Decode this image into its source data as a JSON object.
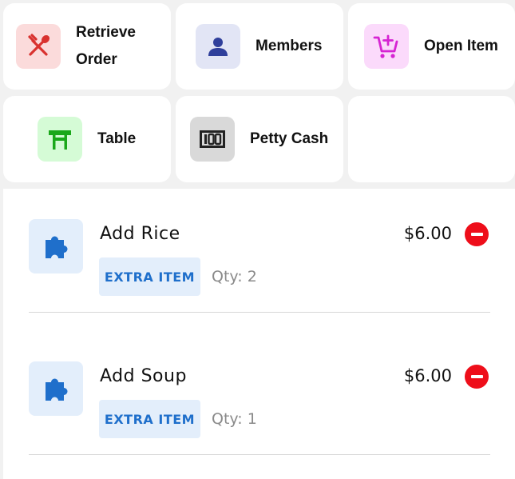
{
  "actions": {
    "retrieve_order": {
      "label": "Retrieve\nOrder",
      "icon": "utensils-icon",
      "color": "#d9322f",
      "bg": "#fbdbdb"
    },
    "members": {
      "label": "Members",
      "icon": "person-icon",
      "color": "#2f3f9b",
      "bg": "#e2e5f5"
    },
    "open_item": {
      "label": "Open Item",
      "icon": "cart-plus-icon",
      "color": "#d624d3",
      "bg": "#fbdafb"
    },
    "table": {
      "label": "Table",
      "icon": "table-icon",
      "color": "#1aa81a",
      "bg": "#d5fbd6"
    },
    "petty_cash": {
      "label": "Petty Cash",
      "icon": "cash-icon",
      "color": "#222222",
      "bg": "#d9d9d9"
    }
  },
  "order_items": [
    {
      "name": "Add Rice",
      "price": "$6.00",
      "badge": "EXTRA ITEM",
      "qty": "Qty: 2",
      "icon": "puzzle-icon"
    },
    {
      "name": "Add Soup",
      "price": "$6.00",
      "badge": "EXTRA ITEM",
      "qty": "Qty: 1",
      "icon": "puzzle-icon"
    }
  ],
  "colors": {
    "accent_blue": "#1f6fcb",
    "remove_red": "#ee0e1a",
    "panel_bg": "#f1f1f1"
  }
}
